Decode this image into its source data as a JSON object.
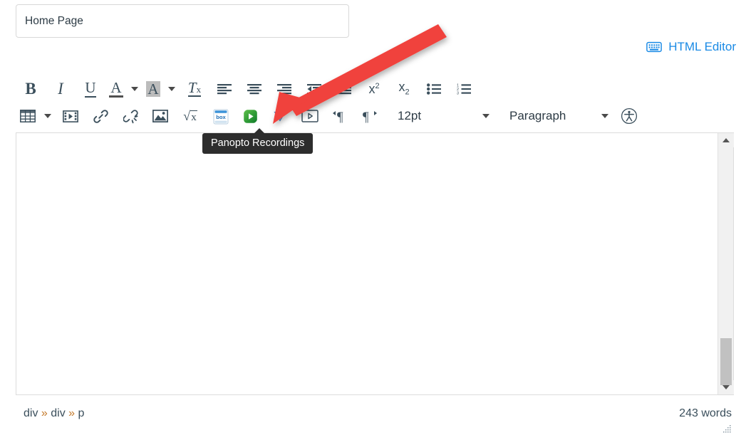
{
  "page": {
    "title_value": "Home Page",
    "title_placeholder": "Page Title"
  },
  "html_editor": {
    "label": "HTML Editor",
    "icon": "keyboard-icon",
    "color": "#1a8ae5"
  },
  "toolbar": {
    "row1": [
      {
        "name": "bold",
        "label": "B",
        "icon": "bold-icon"
      },
      {
        "name": "italic",
        "label": "I",
        "icon": "italic-icon"
      },
      {
        "name": "underline",
        "label": "U",
        "icon": "underline-icon"
      },
      {
        "name": "text-color",
        "label": "A",
        "icon": "text-color-icon"
      },
      {
        "name": "background-color",
        "label": "A",
        "icon": "background-color-icon"
      },
      {
        "name": "clear-formatting",
        "label": "Tx",
        "icon": "clear-formatting-icon"
      },
      {
        "name": "align-left",
        "label": "",
        "icon": "align-left-icon"
      },
      {
        "name": "align-center",
        "label": "",
        "icon": "align-center-icon"
      },
      {
        "name": "align-right",
        "label": "",
        "icon": "align-right-icon"
      },
      {
        "name": "outdent",
        "label": "",
        "icon": "outdent-icon"
      },
      {
        "name": "indent",
        "label": "",
        "icon": "indent-icon"
      },
      {
        "name": "superscript",
        "label": "x2",
        "icon": "superscript-icon"
      },
      {
        "name": "subscript",
        "label": "x2",
        "icon": "subscript-icon"
      },
      {
        "name": "bulleted-list",
        "label": "",
        "icon": "bulleted-list-icon"
      },
      {
        "name": "numbered-list",
        "label": "",
        "icon": "numbered-list-icon"
      }
    ],
    "row2": [
      {
        "name": "table",
        "icon": "table-icon"
      },
      {
        "name": "media",
        "icon": "film-icon"
      },
      {
        "name": "link",
        "icon": "link-icon"
      },
      {
        "name": "unlink",
        "icon": "unlink-icon"
      },
      {
        "name": "image",
        "icon": "image-icon"
      },
      {
        "name": "math-equation",
        "icon": "math-sqrt-icon"
      },
      {
        "name": "box",
        "icon": "box-icon"
      },
      {
        "name": "panopto-recordings",
        "icon": "panopto-icon"
      },
      {
        "name": "vimeo",
        "icon": "blue-v-icon"
      },
      {
        "name": "embed-video",
        "icon": "video-play-icon"
      },
      {
        "name": "ltr-direction",
        "icon": "paragraph-ltr-icon"
      },
      {
        "name": "rtl-direction",
        "icon": "paragraph-rtl-icon"
      }
    ],
    "font_size": {
      "value": "12pt"
    },
    "block_format": {
      "value": "Paragraph"
    },
    "accessibility": {
      "name": "accessibility-checker",
      "icon": "accessibility-icon"
    }
  },
  "tooltip": {
    "text": "Panopto Recordings"
  },
  "statusbar": {
    "element_path": "div » div » p",
    "word_count": "243 words"
  },
  "annotation": {
    "arrow_color": "#f0423c",
    "points_to": "panopto-recordings"
  }
}
